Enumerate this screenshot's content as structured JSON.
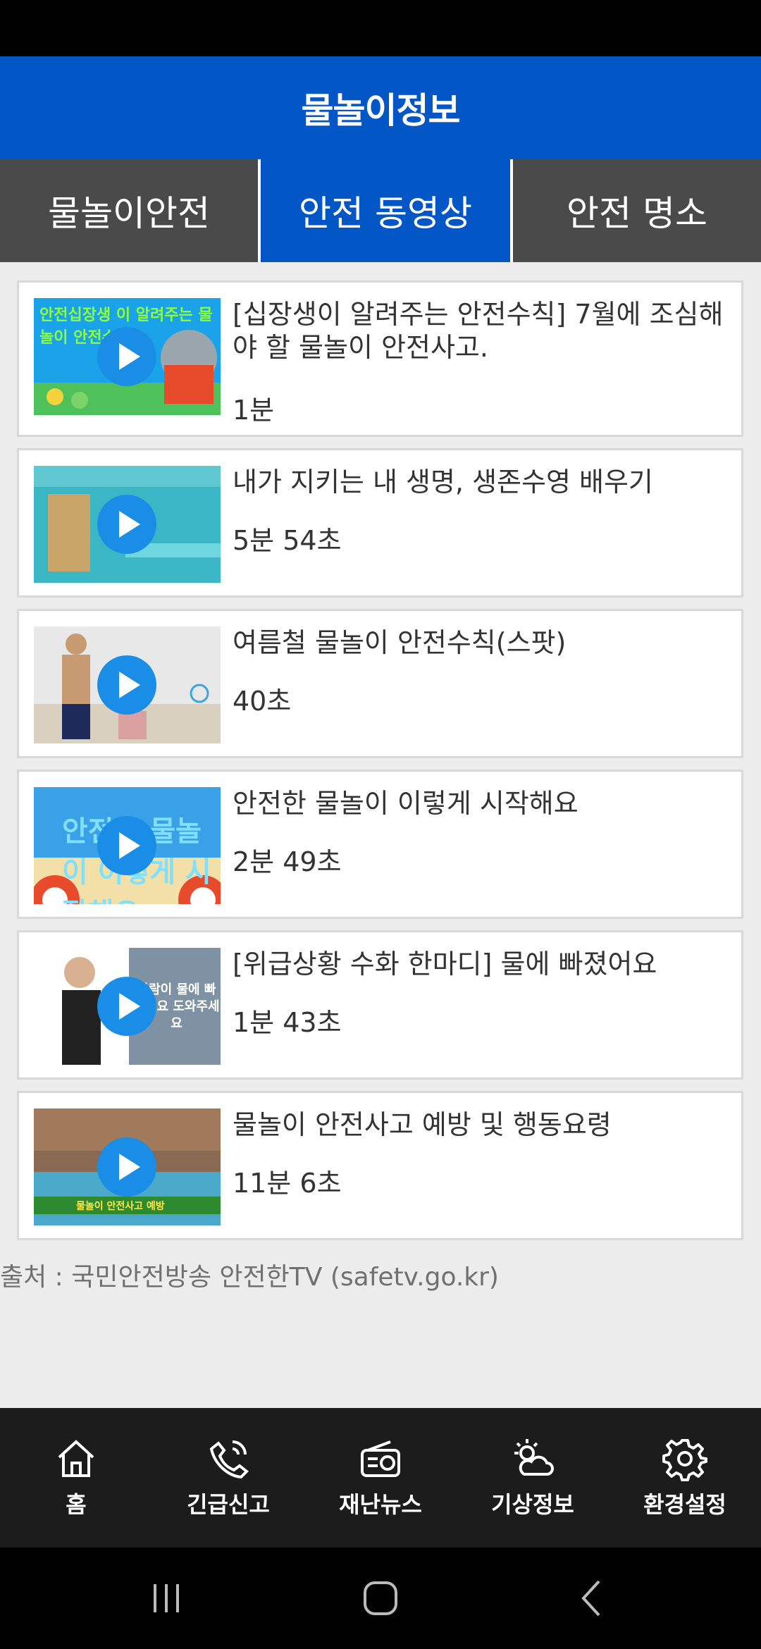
{
  "header": {
    "title": "물놀이정보"
  },
  "tabs": [
    {
      "label": "물놀이안전",
      "active": false
    },
    {
      "label": "안전 동영상",
      "active": true
    },
    {
      "label": "안전 명소",
      "active": false
    }
  ],
  "videos": [
    {
      "title": "[십장생이 알려주는 안전수칙] 7월에 조심해야 할 물놀이 안전사고.",
      "duration": "1분",
      "thumb_text": "안전십장생 이 알려주는 물놀이 안전수칙"
    },
    {
      "title": "내가 지키는 내 생명, 생존수영 배우기",
      "duration": "5분 54초",
      "thumb_text": ""
    },
    {
      "title": "여름철 물놀이 안전수칙(스팟)",
      "duration": "40초",
      "thumb_text": ""
    },
    {
      "title": "안전한 물놀이 이렇게 시작해요",
      "duration": "2분 49초",
      "thumb_text": "안전한 물놀이 이렇게 시작해요"
    },
    {
      "title": "[위급상황 수화 한마디] 물에 빠졌어요",
      "duration": "1분 43초",
      "thumb_text": "사람이 물에 빠졌어요 도와주세요"
    },
    {
      "title": "물놀이 안전사고 예방 및 행동요령",
      "duration": "11분 6초",
      "thumb_text": "물놀이 안전사고 예방"
    }
  ],
  "source": "출처 : 국민안전방송 안전한TV (safetv.go.kr)",
  "bottom_nav": [
    {
      "label": "홈",
      "icon": "home-icon"
    },
    {
      "label": "긴급신고",
      "icon": "phone-icon"
    },
    {
      "label": "재난뉴스",
      "icon": "radio-icon"
    },
    {
      "label": "기상정보",
      "icon": "weather-icon"
    },
    {
      "label": "환경설정",
      "icon": "gear-icon"
    }
  ],
  "system_nav": [
    "recent-apps-icon",
    "home-button-icon",
    "back-icon"
  ],
  "colors": {
    "primary": "#0356c6",
    "tab_inactive": "#4a4a4a",
    "nav_bg": "#1c1c1c",
    "play": "#1a8ee6"
  }
}
